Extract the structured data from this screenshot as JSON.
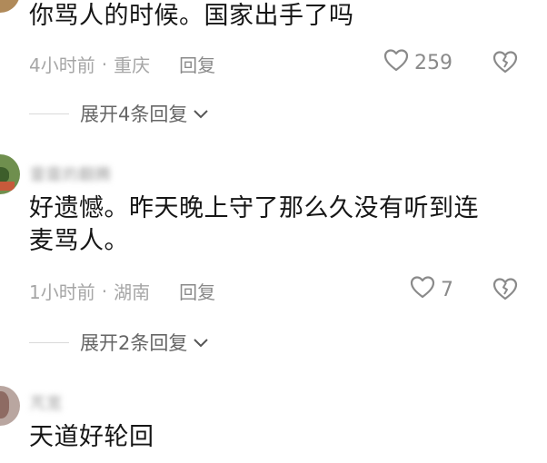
{
  "comments": [
    {
      "text": "你骂人的时候。国家出手了吗",
      "time": "4小时前",
      "dot": "·",
      "location": "重庆",
      "reply": "回复",
      "likes": "259",
      "replies": "展开4条回复"
    },
    {
      "username": "雷霆的翻腾",
      "text_line1": "好遗憾。昨天晚上守了那么久没有听到连",
      "text_line2": "麦骂人。",
      "time": "1小时前",
      "dot": "·",
      "location": "湖南",
      "reply": "回复",
      "likes": "7",
      "replies": "展开2条回复"
    },
    {
      "username": "芃宽",
      "text": "天道好轮回"
    }
  ],
  "icons": {
    "like": "heart-outline-icon",
    "dislike": "broken-heart-icon",
    "expand": "chevron-down-icon"
  }
}
